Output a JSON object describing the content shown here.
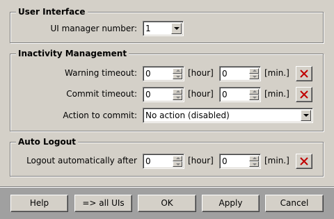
{
  "user_interface": {
    "title": "User Interface",
    "ui_manager_label": "UI manager number:",
    "ui_manager_value": "1"
  },
  "inactivity": {
    "title": "Inactivity Management",
    "warning_label": "Warning timeout:",
    "warning_hours": "0",
    "warning_minutes": "0",
    "commit_label": "Commit timeout:",
    "commit_hours": "0",
    "commit_minutes": "0",
    "action_label": "Action to commit:",
    "action_value": "No action (disabled)"
  },
  "auto_logout": {
    "title": "Auto Logout",
    "label": "Logout automatically after",
    "hours": "0",
    "minutes": "0"
  },
  "units": {
    "hour": "[hour]",
    "min": "[min.]"
  },
  "buttons": {
    "help": "Help",
    "all_uis": "=> all UIs",
    "ok": "OK",
    "apply": "Apply",
    "cancel": "Cancel"
  },
  "colors": {
    "dialog_bg": "#d4d0c8",
    "button_bar_bg": "#a0a0a0",
    "clear_icon_red": "#c00000"
  }
}
